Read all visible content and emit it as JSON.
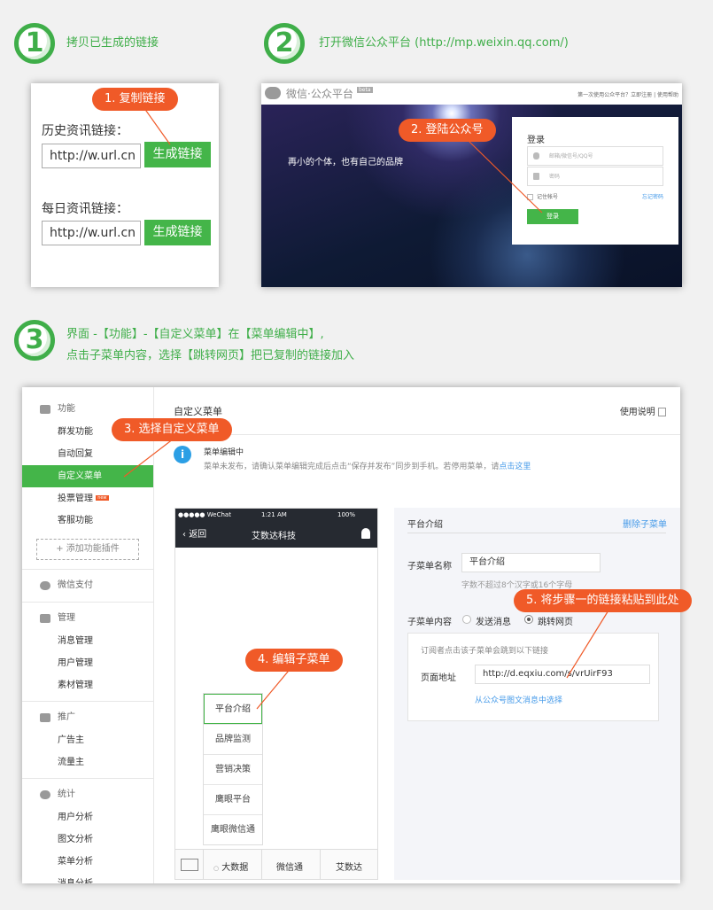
{
  "step1": {
    "num": "1",
    "text": "拷贝已生成的链接"
  },
  "step2": {
    "num": "2",
    "text": "打开微信公众平台 (http://mp.weixin.qq.com/)"
  },
  "step3": {
    "num": "3",
    "line1": "界面 -【功能】-【自定义菜单】在【菜单编辑中】,",
    "line2": "点击子菜单内容，选择【跳转网页】把已复制的链接加入"
  },
  "panel1": {
    "callout": "1. 复制链接",
    "history_label": "历史资讯链接：",
    "history_value": "http://w.url.cn",
    "daily_label": "每日资讯链接：",
    "daily_value": "http://w.url.cn",
    "button": "生成链接"
  },
  "panel2": {
    "logo": "微信·公众平台",
    "beta": "beta",
    "topright": "第一次使用公众平台？立即注册 | 使用帮助",
    "slogan": "再小的个体，也有自己的品牌",
    "callout": "2. 登陆公众号",
    "login_title": "登录",
    "email_placeholder": "邮箱/微信号/QQ号",
    "password_placeholder": "密码",
    "remember": "记住帐号",
    "forgot": "忘记密码",
    "login_button": "登录"
  },
  "panel3": {
    "sidebar": {
      "func_head": "功能",
      "items": [
        "群发功能",
        "自动回复",
        "自定义菜单",
        "投票管理",
        "客服功能"
      ],
      "new_badge": "new",
      "add_plugin": "+ 添加功能插件",
      "pay": "微信支付",
      "manage_head": "管理",
      "manage_items": [
        "消息管理",
        "用户管理",
        "素材管理"
      ],
      "promo_head": "推广",
      "promo_items": [
        "广告主",
        "流量主"
      ],
      "stats_head": "统计",
      "stats_items": [
        "用户分析",
        "图文分析",
        "菜单分析",
        "消息分析"
      ]
    },
    "title": "自定义菜单",
    "help": "使用说明",
    "callout3": "3. 选择自定义菜单",
    "notice_title": "菜单编辑中",
    "notice_text": "菜单未发布，请确认菜单编辑完成后点击“保存并发布”同步到手机。若停用菜单，请",
    "notice_link": "点击这里",
    "phone": {
      "carrier": "●●●●● WeChat",
      "time": "1:21 AM",
      "battery": "100%",
      "back": "返回",
      "name": "艾数达科技",
      "submenu": [
        "平台介绍",
        "品牌监测",
        "营销决策",
        "鹰眼平台",
        "鹰眼微信通"
      ],
      "bottom": [
        "大数据",
        "微信通",
        "艾数达"
      ]
    },
    "callout4": "4. 编辑子菜单",
    "edit": {
      "header": "平台介绍",
      "delete": "删除子菜单",
      "name_label": "子菜单名称",
      "name_value": "平台介绍",
      "name_hint": "字数不超过8个汉字或16个字母",
      "content_label": "子菜单内容",
      "opt_send": "发送消息",
      "opt_jump": "跳转网页",
      "box_hint": "订阅者点击该子菜单会跳到以下链接",
      "url_label": "页面地址",
      "url_value": "http://d.eqxiu.com/s/vrUirF93",
      "pick_link": "从公众号图文消息中选择"
    },
    "callout5": "5. 将步骤一的链接粘贴到此处"
  },
  "colors": {
    "green": "#44b549",
    "orange": "#f05a28",
    "step_green": "#3fae49"
  }
}
